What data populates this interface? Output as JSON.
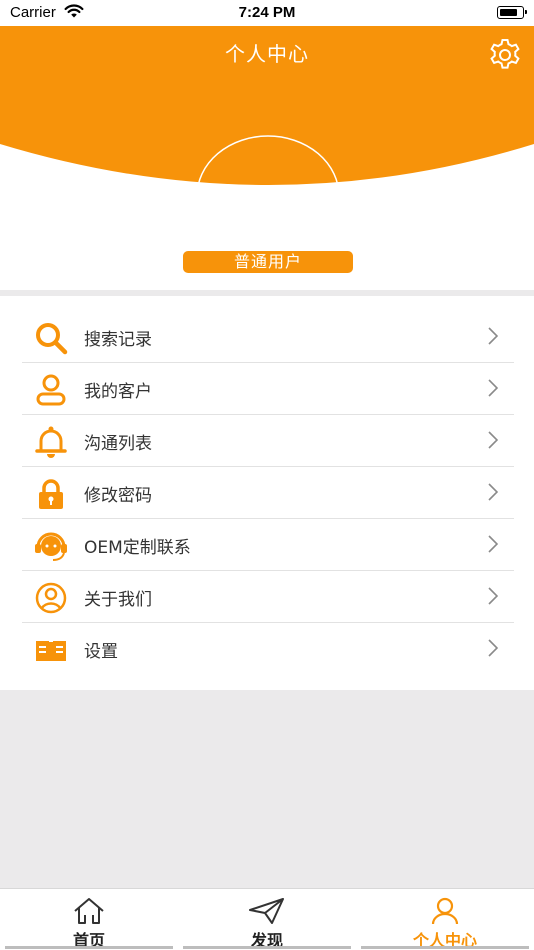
{
  "status_bar": {
    "carrier": "Carrier",
    "time": "7:24 PM"
  },
  "header": {
    "title": "个人中心",
    "user_type": "普通用户"
  },
  "menu": {
    "items": [
      {
        "label": "搜索记录",
        "icon": "search-icon"
      },
      {
        "label": "我的客户",
        "icon": "user-icon"
      },
      {
        "label": "沟通列表",
        "icon": "bell-icon"
      },
      {
        "label": "修改密码",
        "icon": "lock-icon"
      },
      {
        "label": "OEM定制联系",
        "icon": "headset-icon"
      },
      {
        "label": "关于我们",
        "icon": "user-circle-icon"
      },
      {
        "label": "设置",
        "icon": "book-icon"
      }
    ]
  },
  "tabbar": {
    "tabs": [
      {
        "label": "首页",
        "icon": "home-icon",
        "active": false
      },
      {
        "label": "发现",
        "icon": "paper-plane-icon",
        "active": false
      },
      {
        "label": "个人中心",
        "icon": "person-icon",
        "active": true
      }
    ]
  },
  "colors": {
    "accent": "#f7930a",
    "background": "#ebeaeb"
  }
}
